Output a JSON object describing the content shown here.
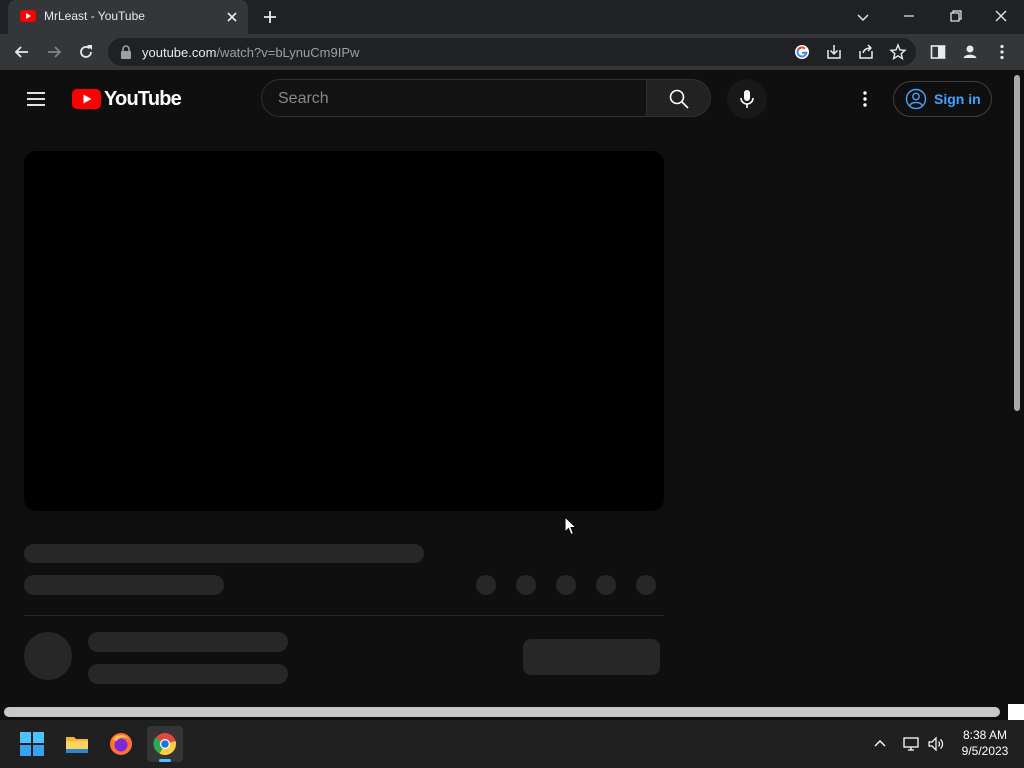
{
  "browser": {
    "tab": {
      "title": "MrLeast - YouTube"
    },
    "address": {
      "host": "youtube.com",
      "path": "/watch?v=bLynuCm9IPw"
    }
  },
  "youtube": {
    "logo_text": "YouTube",
    "search": {
      "placeholder": "Search",
      "value": ""
    },
    "sign_in_label": "Sign in",
    "brand_color": "#ff0000",
    "link_color": "#3ea6ff"
  },
  "taskbar": {
    "apps": [
      "start-icon",
      "file-explorer-icon",
      "firefox-icon",
      "chrome-icon"
    ],
    "time": "8:38 AM",
    "date": "9/5/2023"
  }
}
